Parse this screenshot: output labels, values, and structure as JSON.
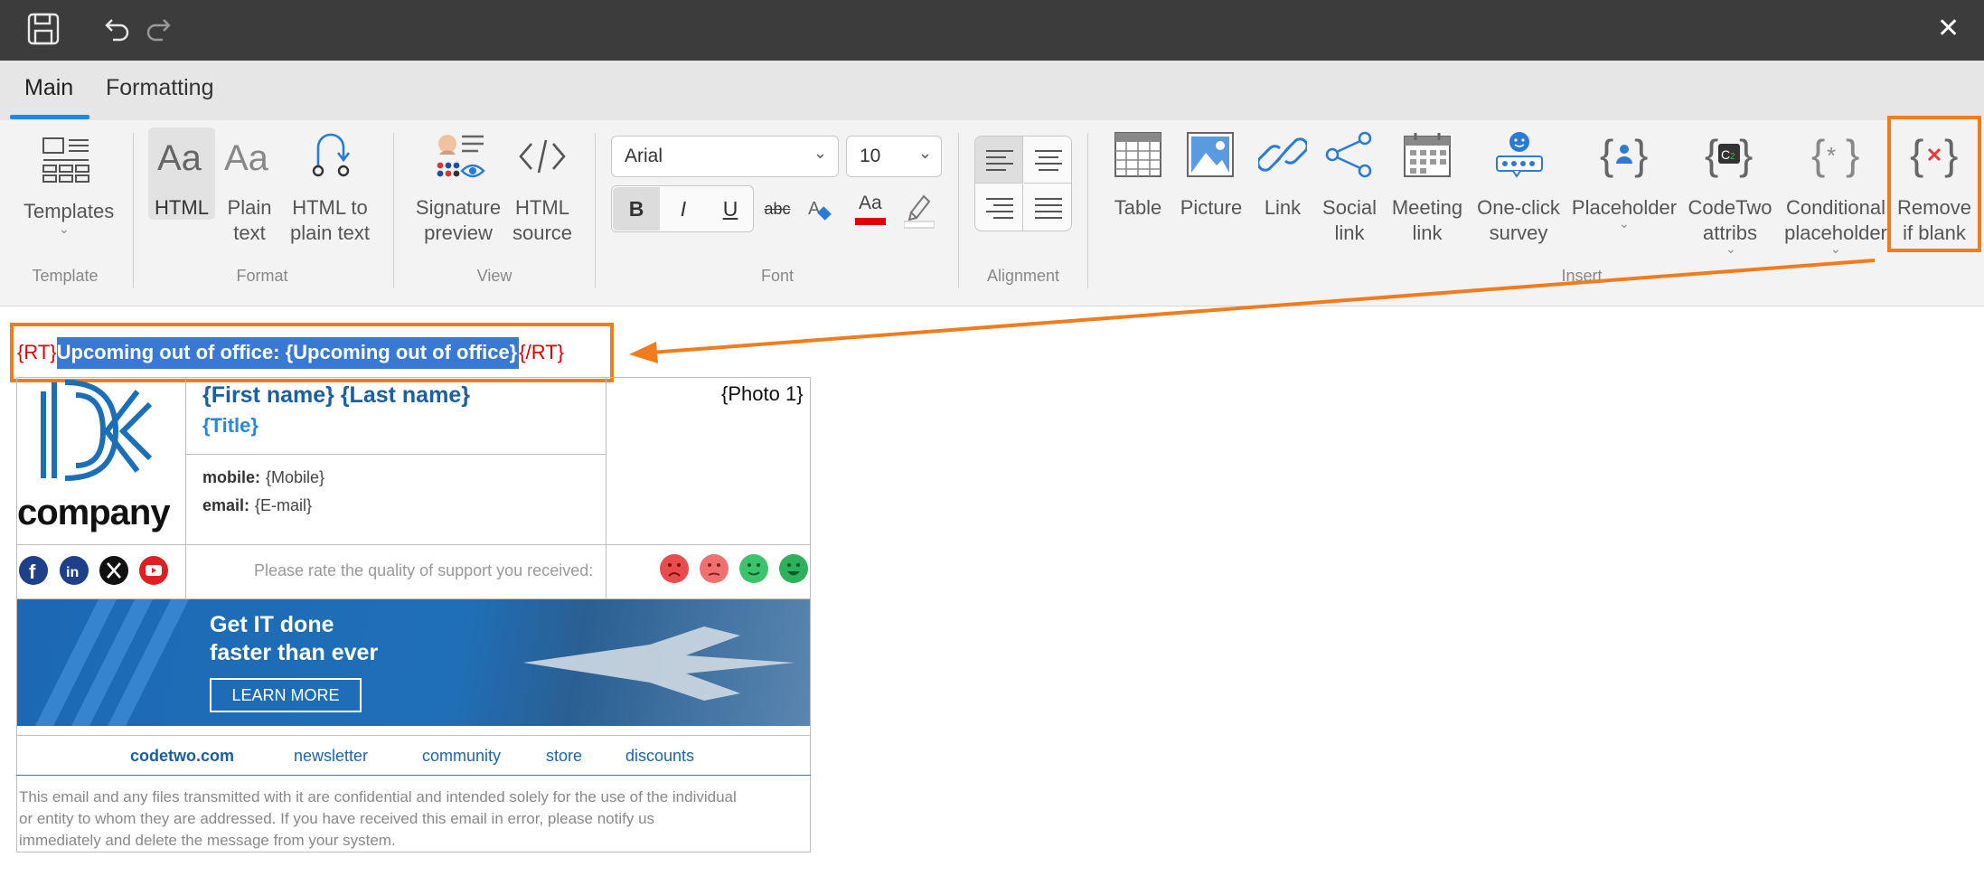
{
  "titlebar": {
    "close_glyph": "✕"
  },
  "tabs": [
    {
      "label": "Main",
      "active": true
    },
    {
      "label": "Formatting",
      "active": false
    }
  ],
  "ribbon": {
    "template": {
      "group_label": "Template",
      "templates_label": "Templates"
    },
    "format": {
      "group_label": "Format",
      "html_label": "HTML",
      "plain_text_label_1": "Plain",
      "plain_text_label_2": "text",
      "html_to_plain_label_1": "HTML to",
      "html_to_plain_label_2": "plain text"
    },
    "view": {
      "group_label": "View",
      "sig_preview_label_1": "Signature",
      "sig_preview_label_2": "preview",
      "html_source_label_1": "HTML",
      "html_source_label_2": "source"
    },
    "font": {
      "group_label": "Font",
      "font_family": "Arial",
      "font_size": "10",
      "bold": "B",
      "italic": "I",
      "underline": "U",
      "strike": "abc",
      "font_color": "Aa",
      "font_color_value": "#e00000"
    },
    "alignment": {
      "group_label": "Alignment"
    },
    "insert": {
      "group_label": "Insert",
      "table_label": "Table",
      "picture_label": "Picture",
      "link_label": "Link",
      "social_link_label_1": "Social",
      "social_link_label_2": "link",
      "meeting_link_label_1": "Meeting",
      "meeting_link_label_2": "link",
      "survey_label_1": "One-click",
      "survey_label_2": "survey",
      "placeholder_label": "Placeholder",
      "codetwo_label_1": "CodeTwo",
      "codetwo_label_2": "attribs",
      "conditional_label_1": "Conditional",
      "conditional_label_2": "placeholder",
      "remove_blank_label_1": "Remove",
      "remove_blank_label_2": "if blank"
    }
  },
  "signature": {
    "rt_open": "{RT}",
    "rt_text": "Upcoming out of office: {Upcoming out of office}",
    "rt_close": "{/RT}",
    "company_word": "company",
    "name": "{First name} {Last name}",
    "title": "{Title}",
    "photo": "{Photo 1}",
    "mobile_label": "mobile:",
    "mobile_value": "{Mobile}",
    "email_label": "email:",
    "email_value": "{E-mail}",
    "rate_text": "Please rate the quality of support you received:",
    "banner_line1": "Get IT done",
    "banner_line2": "faster than ever",
    "banner_button": "LEARN MORE",
    "links": [
      "codetwo.com",
      "newsletter",
      "community",
      "store",
      "discounts"
    ],
    "disclaimer_1": "This email and any files transmitted with it are confidential and intended solely for the use of the individual",
    "disclaimer_2": "or entity to whom they are addressed. If you have received this email in error, please notify us",
    "disclaimer_3": "immediately and delete the message from your system."
  },
  "colors": {
    "accent": "#1e88e5",
    "highlight": "#f07c1b",
    "selection": "#3a78d6",
    "rt_tag": "#e00000",
    "name": "#1a5fa0",
    "banner": "#1f6fb8"
  }
}
